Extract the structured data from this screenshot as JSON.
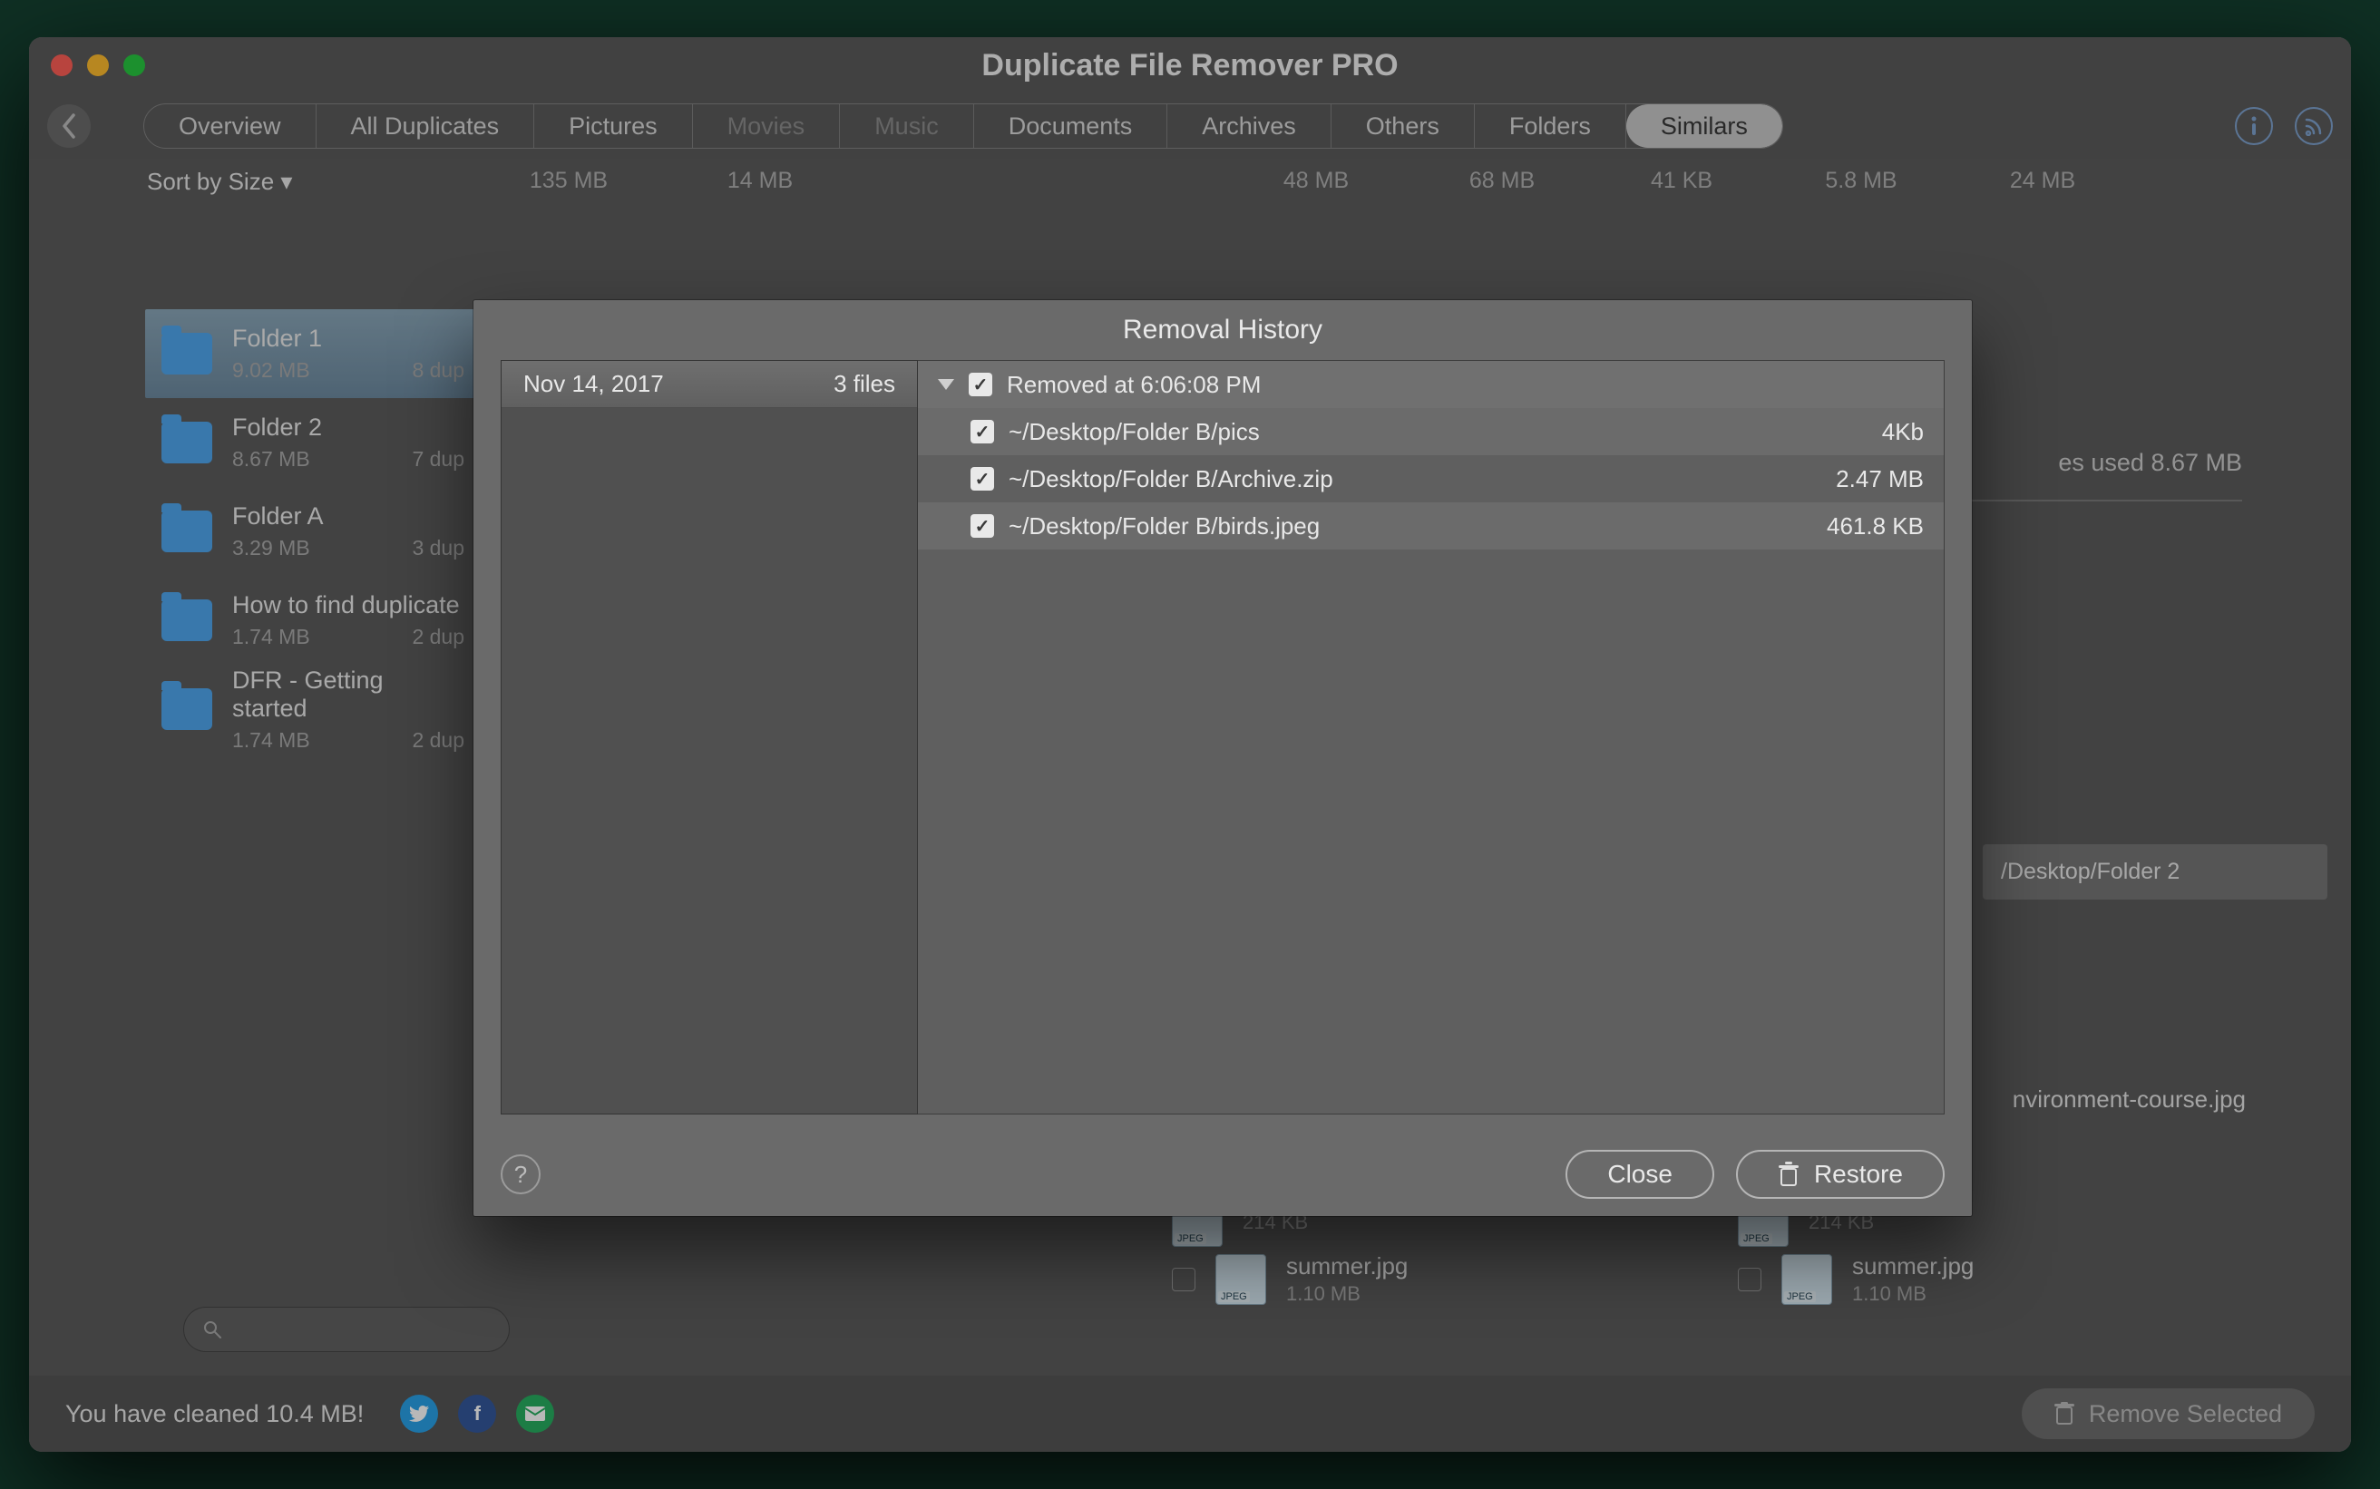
{
  "title": "Duplicate File Remover PRO",
  "toolbar": {
    "tabs": [
      "Overview",
      "All Duplicates",
      "Pictures",
      "Movies",
      "Music",
      "Documents",
      "Archives",
      "Others",
      "Folders",
      "Similars"
    ],
    "sizes": [
      "",
      "135 MB",
      "14 MB",
      "",
      "",
      "48 MB",
      "68 MB",
      "41 KB",
      "5.8 MB",
      "24 MB"
    ]
  },
  "sort_label": "Sort by Size ▾",
  "sidebar": [
    {
      "name": "Folder 1",
      "size": "9.02 MB",
      "dup": "8 dup"
    },
    {
      "name": "Folder 2",
      "size": "8.67 MB",
      "dup": "7 dup"
    },
    {
      "name": "Folder A",
      "size": "3.29 MB",
      "dup": "3 dup"
    },
    {
      "name": "How to find duplicate",
      "size": "1.74 MB",
      "dup": "2 dup"
    },
    {
      "name": "DFR - Getting started",
      "size": "1.74 MB",
      "dup": "2 dup"
    }
  ],
  "right_meta": "es used 8.67 MB",
  "right_path": "/Desktop/Folder 2",
  "right_files": {
    "env": {
      "name": "nvironment-course.jpg"
    },
    "a": {
      "name": "",
      "size": "214 KB"
    },
    "b": {
      "name": "",
      "size": "214 KB"
    },
    "c": {
      "name": "summer.jpg",
      "size": "1.10 MB"
    },
    "d": {
      "name": "summer.jpg",
      "size": "1.10 MB"
    }
  },
  "modal": {
    "title": "Removal History",
    "session": {
      "date": "Nov 14, 2017",
      "count": "3 files"
    },
    "group_header": "Removed at 6:06:08 PM",
    "items": [
      {
        "path": "~/Desktop/Folder B/pics",
        "size": "4Kb"
      },
      {
        "path": "~/Desktop/Folder B/Archive.zip",
        "size": "2.47 MB"
      },
      {
        "path": "~/Desktop/Folder B/birds.jpeg",
        "size": "461.8 KB"
      }
    ],
    "close": "Close",
    "restore": "Restore"
  },
  "footer": {
    "msg": "You have cleaned 10.4 MB!",
    "remove": "Remove Selected"
  }
}
